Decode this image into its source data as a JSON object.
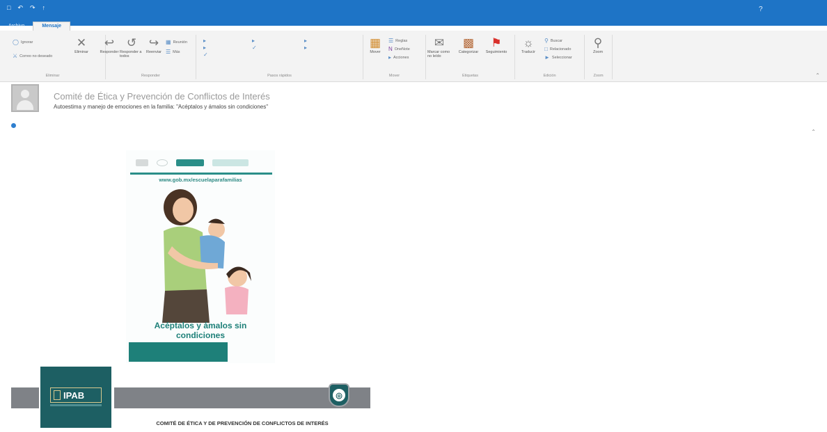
{
  "window": {
    "title": "",
    "tabs": [
      {
        "label": "Archivo"
      },
      {
        "label": "Mensaje"
      },
      {
        "label": ""
      }
    ]
  },
  "ribbon": {
    "groups": [
      {
        "label": "Eliminar"
      },
      {
        "label": "Responder"
      },
      {
        "label": "Pasos rápidos"
      },
      {
        "label": "Mover"
      },
      {
        "label": "Etiquetas"
      },
      {
        "label": "Edición"
      },
      {
        "label": "Zoom"
      }
    ],
    "buttons": {
      "ignore": "Ignorar",
      "junk": "Correo no deseado",
      "delete": "Eliminar",
      "reply": "Responder",
      "reply_all": "Responder a todos",
      "forward": "Reenviar",
      "meeting": "Reunión",
      "more": "Más",
      "move": "Mover",
      "rules": "Reglas",
      "onenote": "OneNote",
      "actions": "Acciones",
      "mark_unread": "Marcar como no leído",
      "categorize": "Categorizar",
      "follow_up": "Seguimiento",
      "translate": "Traducir",
      "search": "Buscar",
      "related": "Relacionado",
      "select": "Seleccionar",
      "zoom": "Zoom"
    }
  },
  "message": {
    "date": "",
    "sender": "Comité de Ética y Prevención de Conflictos de Interés",
    "subject": "Autoestima y manejo de emociones en la familia: \"Acéptalos y ámalos sin condiciones\"",
    "to": "",
    "info": ""
  },
  "flyer": {
    "url": "www.gob.mx/escuelaparafamilias",
    "title": "Acéptalos y ámalos sin condiciones",
    "band_text": ""
  },
  "banner": {
    "logo_text": "IPAB",
    "date_text": "",
    "caption": "COMITÉ DE ÉTICA Y DE PREVENCIÓN DE CONFLICTOS DE INTERÉS"
  }
}
